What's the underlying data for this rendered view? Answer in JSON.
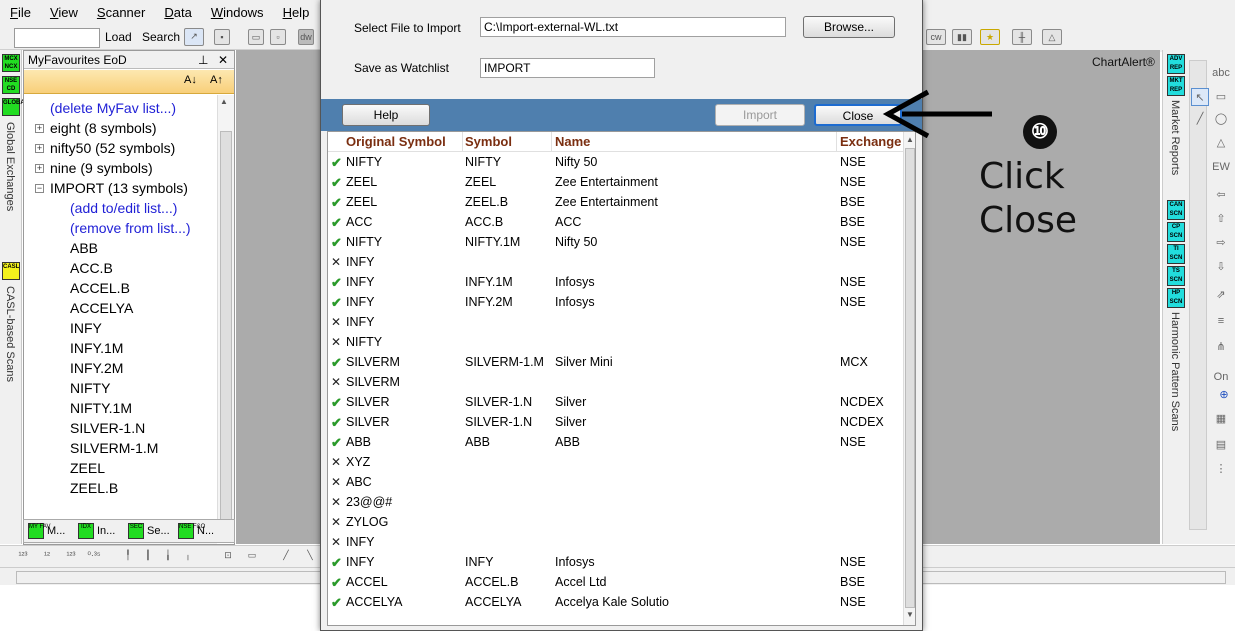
{
  "menu": [
    "File",
    "View",
    "Scanner",
    "Data",
    "Windows",
    "Help"
  ],
  "toolbar": {
    "load_label": "Load",
    "search_label": "Search"
  },
  "left_strip": {
    "tags": [
      "MCX NCX",
      "NSE CD",
      "GLOBAL",
      "CASL"
    ],
    "vertical_labels": [
      "Global Exchanges",
      "CASL-based Scans"
    ]
  },
  "favourites": {
    "title": "MyFavourites EoD",
    "pin_icon": "pin-icon",
    "close_glyph": "✕",
    "items": [
      {
        "label": "(delete MyFav list...)",
        "type": "link",
        "indent": 0
      },
      {
        "label": "eight (8 symbols)",
        "type": "folder",
        "indent": 0
      },
      {
        "label": "nifty50 (52 symbols)",
        "type": "folder",
        "indent": 0
      },
      {
        "label": "nine (9 symbols)",
        "type": "folder",
        "indent": 0
      },
      {
        "label": "IMPORT (13 symbols)",
        "type": "folder-open",
        "indent": 0
      },
      {
        "label": "(add to/edit list...)",
        "type": "link",
        "indent": 1
      },
      {
        "label": "(remove from list...)",
        "type": "link",
        "indent": 1
      },
      {
        "label": "ABB",
        "type": "item",
        "indent": 1
      },
      {
        "label": "ACC.B",
        "type": "item",
        "indent": 1
      },
      {
        "label": "ACCEL.B",
        "type": "item",
        "indent": 1
      },
      {
        "label": "ACCELYA",
        "type": "item",
        "indent": 1
      },
      {
        "label": "INFY",
        "type": "item",
        "indent": 1
      },
      {
        "label": "INFY.1M",
        "type": "item",
        "indent": 1
      },
      {
        "label": "INFY.2M",
        "type": "item",
        "indent": 1
      },
      {
        "label": "NIFTY",
        "type": "item",
        "indent": 1
      },
      {
        "label": "NIFTY.1M",
        "type": "item",
        "indent": 1
      },
      {
        "label": "SILVER-1.N",
        "type": "item",
        "indent": 1
      },
      {
        "label": "SILVERM-1.M",
        "type": "item",
        "indent": 1
      },
      {
        "label": "ZEEL",
        "type": "item",
        "indent": 1
      },
      {
        "label": "ZEEL.B",
        "type": "item",
        "indent": 1
      }
    ],
    "tabs": [
      {
        "tag": "MY FAV",
        "label": "M..."
      },
      {
        "tag": "IDX",
        "label": "In..."
      },
      {
        "tag": "SEC",
        "label": "Se..."
      },
      {
        "tag": "NSE F&O",
        "label": "N..."
      }
    ]
  },
  "chart_alert_label": "ChartAlert®",
  "right_strip": {
    "tags": [
      "ADV REP",
      "MKT REP",
      "CAN SCN",
      "CP SCN",
      "TI SCN",
      "TS SCN",
      "HP SCN"
    ],
    "vertical_labels": [
      "Market Reports",
      "Harmonic Pattern Scans"
    ]
  },
  "dialog": {
    "select_file_label": "Select File to Import",
    "select_file_value": "C:\\Import-external-WL.txt",
    "browse_label": "Browse...",
    "save_as_label": "Save as Watchlist",
    "save_as_value": "IMPORT",
    "help_label": "Help",
    "import_label": "Import",
    "close_label": "Close",
    "columns": [
      "Original Symbol",
      "Symbol",
      "Name",
      "Exchange"
    ],
    "rows": [
      {
        "status": "ok",
        "orig": "NIFTY",
        "sym": "NIFTY",
        "name": "Nifty 50",
        "exch": "NSE"
      },
      {
        "status": "ok",
        "orig": "ZEEL",
        "sym": "ZEEL",
        "name": "Zee Entertainment",
        "exch": "NSE"
      },
      {
        "status": "ok",
        "orig": "ZEEL",
        "sym": "ZEEL.B",
        "name": "Zee Entertainment",
        "exch": "BSE"
      },
      {
        "status": "ok",
        "orig": "ACC",
        "sym": "ACC.B",
        "name": "ACC",
        "exch": "BSE"
      },
      {
        "status": "ok",
        "orig": "NIFTY",
        "sym": "NIFTY.1M",
        "name": "Nifty 50",
        "exch": "NSE"
      },
      {
        "status": "bad",
        "orig": "INFY",
        "sym": "",
        "name": "",
        "exch": ""
      },
      {
        "status": "ok",
        "orig": "INFY",
        "sym": "INFY.1M",
        "name": "Infosys",
        "exch": "NSE"
      },
      {
        "status": "ok",
        "orig": "INFY",
        "sym": "INFY.2M",
        "name": "Infosys",
        "exch": "NSE"
      },
      {
        "status": "bad",
        "orig": "INFY",
        "sym": "",
        "name": "",
        "exch": ""
      },
      {
        "status": "bad",
        "orig": "NIFTY",
        "sym": "",
        "name": "",
        "exch": ""
      },
      {
        "status": "ok",
        "orig": "SILVERM",
        "sym": "SILVERM-1.M",
        "name": "Silver Mini",
        "exch": "MCX"
      },
      {
        "status": "bad",
        "orig": "SILVERM",
        "sym": "",
        "name": "",
        "exch": ""
      },
      {
        "status": "ok",
        "orig": "SILVER",
        "sym": "SILVER-1.N",
        "name": "Silver",
        "exch": "NCDEX"
      },
      {
        "status": "ok",
        "orig": "SILVER",
        "sym": "SILVER-1.N",
        "name": "Silver",
        "exch": "NCDEX"
      },
      {
        "status": "ok",
        "orig": "ABB",
        "sym": "ABB",
        "name": "ABB",
        "exch": "NSE"
      },
      {
        "status": "bad",
        "orig": "XYZ",
        "sym": "",
        "name": "",
        "exch": ""
      },
      {
        "status": "bad",
        "orig": "ABC",
        "sym": "",
        "name": "",
        "exch": ""
      },
      {
        "status": "bad",
        "orig": "23@@#",
        "sym": "",
        "name": "",
        "exch": ""
      },
      {
        "status": "bad",
        "orig": "ZYLOG",
        "sym": "",
        "name": "",
        "exch": ""
      },
      {
        "status": "bad",
        "orig": "INFY",
        "sym": "",
        "name": "",
        "exch": ""
      },
      {
        "status": "ok",
        "orig": "INFY",
        "sym": "INFY",
        "name": "Infosys",
        "exch": "NSE"
      },
      {
        "status": "ok",
        "orig": "ACCEL",
        "sym": "ACCEL.B",
        "name": "Accel Ltd",
        "exch": "BSE"
      },
      {
        "status": "ok",
        "orig": "ACCELYA",
        "sym": "ACCELYA",
        "name": "Accelya Kale Solutio",
        "exch": "NSE"
      }
    ]
  },
  "annotation": {
    "step": "⑩",
    "line1": "Click",
    "line2": "Close",
    "arrow_color": "#000000"
  },
  "colors": {
    "button_bar": "#4f7fae",
    "header_text": "#7a2e10",
    "link": "#1f1fd6",
    "workspace": "#ababab"
  }
}
